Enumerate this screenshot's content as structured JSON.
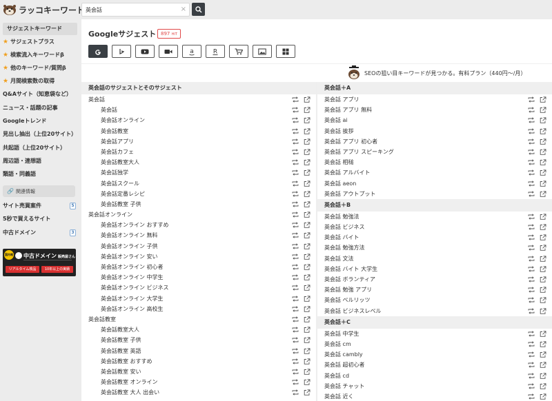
{
  "header": {
    "logo_text": "ラッコキーワード",
    "search_value": "英会話"
  },
  "sidebar": {
    "items": [
      {
        "label": "サジェストキーワード",
        "star": false
      },
      {
        "label": "サジェストプラス",
        "star": true
      },
      {
        "label": "検索流入キーワードβ",
        "star": true
      },
      {
        "label": "他のキーワード/質問β",
        "star": true
      },
      {
        "label": "月間検索数の取得",
        "star": true
      },
      {
        "label": "Q&Aサイト（知恵袋など）",
        "star": false
      },
      {
        "label": "ニュース・話題の記事",
        "star": false
      },
      {
        "label": "Googleトレンド",
        "star": false
      },
      {
        "label": "見出し抽出（上位20サイト）",
        "star": false
      },
      {
        "label": "共起語（上位20サイト）",
        "star": false
      },
      {
        "label": "周辺語・連想語",
        "star": false
      },
      {
        "label": "類語・同義語",
        "star": false
      }
    ],
    "related_label": "関連情報",
    "links": [
      {
        "label": "サイト売買案件",
        "badge": "5"
      },
      {
        "label": "5秒で買えるサイト",
        "badge": ""
      },
      {
        "label": "中古ドメイン",
        "badge": "3"
      }
    ],
    "banner": {
      "tag": "国内唯一",
      "title": "中古ドメイン",
      "title_small": "販売屋さん",
      "btn1": "リアルタイム検品",
      "btn2": "10年以上の実績"
    }
  },
  "main": {
    "title": "Googleサジェスト",
    "hit_count": "897",
    "hit_unit": "HIT",
    "engines": [
      "google-icon",
      "bing-icon",
      "youtube-icon",
      "video-icon",
      "amazon-icon",
      "rakuten-icon",
      "shopping-cart-icon",
      "image-icon",
      "apps-icon"
    ],
    "promo_text": "SEOの狙い目キーワードが見つかる。有料プラン（440円〜/月）",
    "left_header": "英会話のサジェストとそのサジェスト",
    "left_rows": [
      {
        "text": "英会話",
        "child": false
      },
      {
        "text": "英会話",
        "child": true
      },
      {
        "text": "英会話オンライン",
        "child": true
      },
      {
        "text": "英会話教室",
        "child": true
      },
      {
        "text": "英会話アプリ",
        "child": true
      },
      {
        "text": "英会話カフェ",
        "child": true
      },
      {
        "text": "英会話教室大人",
        "child": true
      },
      {
        "text": "英会話独学",
        "child": true
      },
      {
        "text": "英会話スクール",
        "child": true
      },
      {
        "text": "英会話定番レシピ",
        "child": true
      },
      {
        "text": "英会話教室 子供",
        "child": true
      },
      {
        "text": "英会話オンライン",
        "child": false
      },
      {
        "text": "英会話オンライン おすすめ",
        "child": true
      },
      {
        "text": "英会話オンライン 無料",
        "child": true
      },
      {
        "text": "英会話オンライン 子供",
        "child": true
      },
      {
        "text": "英会話オンライン 安い",
        "child": true
      },
      {
        "text": "英会話オンライン 初心者",
        "child": true
      },
      {
        "text": "英会話オンライン 中学生",
        "child": true
      },
      {
        "text": "英会話オンライン ビジネス",
        "child": true
      },
      {
        "text": "英会話オンライン 大学生",
        "child": true
      },
      {
        "text": "英会話オンライン 高校生",
        "child": true
      },
      {
        "text": "英会話教室",
        "child": false
      },
      {
        "text": "英会話教室大人",
        "child": true
      },
      {
        "text": "英会話教室 子供",
        "child": true
      },
      {
        "text": "英会話教室 英語",
        "child": true
      },
      {
        "text": "英会話教室 おすすめ",
        "child": true
      },
      {
        "text": "英会話教室 安い",
        "child": true
      },
      {
        "text": "英会話教室 オンライン",
        "child": true
      },
      {
        "text": "英会話教室 大人 出会い",
        "child": true
      }
    ],
    "right_sections": [
      {
        "header": "英会話＋A",
        "rows": [
          "英会話 アプリ",
          "英会話 アプリ 無料",
          "英会話 ai",
          "英会話 挨拶",
          "英会話 アプリ 初心者",
          "英会話 アプリ スピーキング",
          "英会話 相槌",
          "英会話 アルバイト",
          "英会話 aeon",
          "英会話 アウトプット"
        ]
      },
      {
        "header": "英会話＋B",
        "rows": [
          "英会話 勉強法",
          "英会話 ビジネス",
          "英会話 バイト",
          "英会話 勉強方法",
          "英会話 文法",
          "英会話 バイト 大学生",
          "英会話 ボランティア",
          "英会話 勉強 アプリ",
          "英会話 ベルリッツ",
          "英会話 ビジネスレベル"
        ]
      },
      {
        "header": "英会話＋C",
        "rows": [
          "英会話 中学生",
          "英会話 cm",
          "英会話 cambly",
          "英会話 超初心者",
          "英会話 cd",
          "英会話 チャット",
          "英会話 近く"
        ]
      }
    ]
  }
}
